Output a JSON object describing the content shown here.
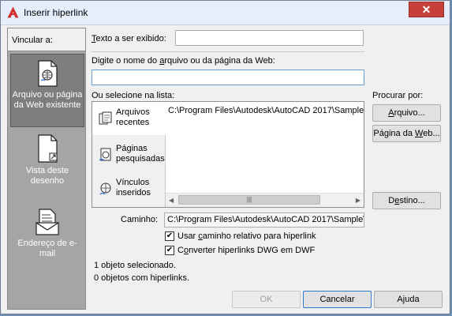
{
  "window": {
    "title": "Inserir hiperlink",
    "close_glyph": "✕"
  },
  "sidebar": {
    "header": "Vincular a:",
    "items": [
      {
        "line1": "Arquivo ou página",
        "line2": "da Web existente",
        "icon": "web-page-icon"
      },
      {
        "line1": "Vista deste",
        "line2": "desenho",
        "icon": "drawing-view-icon"
      },
      {
        "line1": "Endereço de e-mail",
        "line2": "",
        "icon": "email-icon"
      }
    ]
  },
  "display_text": {
    "pre": "",
    "ul": "T",
    "post": "exto a ser exibido:",
    "value": ""
  },
  "filename": {
    "pre": "Digite o nome do ",
    "ul": "a",
    "post": "rquivo ou da página da Web:",
    "value": ""
  },
  "list": {
    "label_pre": "Ou selecione na lista:",
    "tabs": [
      {
        "line1": "Arquivos",
        "line2": "recentes",
        "icon": "recent-files-icon"
      },
      {
        "line1": "Páginas",
        "line2": "pesquisadas",
        "icon": "browsed-pages-icon"
      },
      {
        "line1": "Vínculos",
        "line2": "inseridos",
        "icon": "inserted-links-icon"
      }
    ],
    "items": [
      "C:\\Program Files\\Autodesk\\AutoCAD 2017\\Sample\\"
    ]
  },
  "browse": {
    "label": "Procurar por:",
    "file_btn": {
      "ul": "A",
      "post": "rquivo..."
    },
    "web_btn": {
      "pre": "Página da ",
      "ul": "W",
      "post": "eb..."
    },
    "target_btn": {
      "pre": "D",
      "ul": "e",
      "post": "stino..."
    }
  },
  "path": {
    "label": "Caminho:",
    "value": "C:\\Program Files\\Autodesk\\AutoCAD 2017\\Sample\\"
  },
  "options": [
    {
      "pre": "Usar ",
      "ul": "c",
      "post": "aminho relativo para hiperlink",
      "checked": true
    },
    {
      "pre": "C",
      "ul": "o",
      "post": "nverter hiperlinks DWG em DWF",
      "checked": true
    }
  ],
  "status": {
    "selected": "1 objeto selecionado.",
    "with_links": "0 objetos com hiperlinks."
  },
  "buttons": {
    "ok": "OK",
    "cancel": "Cancelar",
    "help_pre": "A",
    "help_ul": "j",
    "help_post": "uda"
  },
  "colors": {
    "sidebar_bg": "#a5a5a5",
    "sidebar_active": "#7e7e7e",
    "close_red": "#c7413a"
  }
}
